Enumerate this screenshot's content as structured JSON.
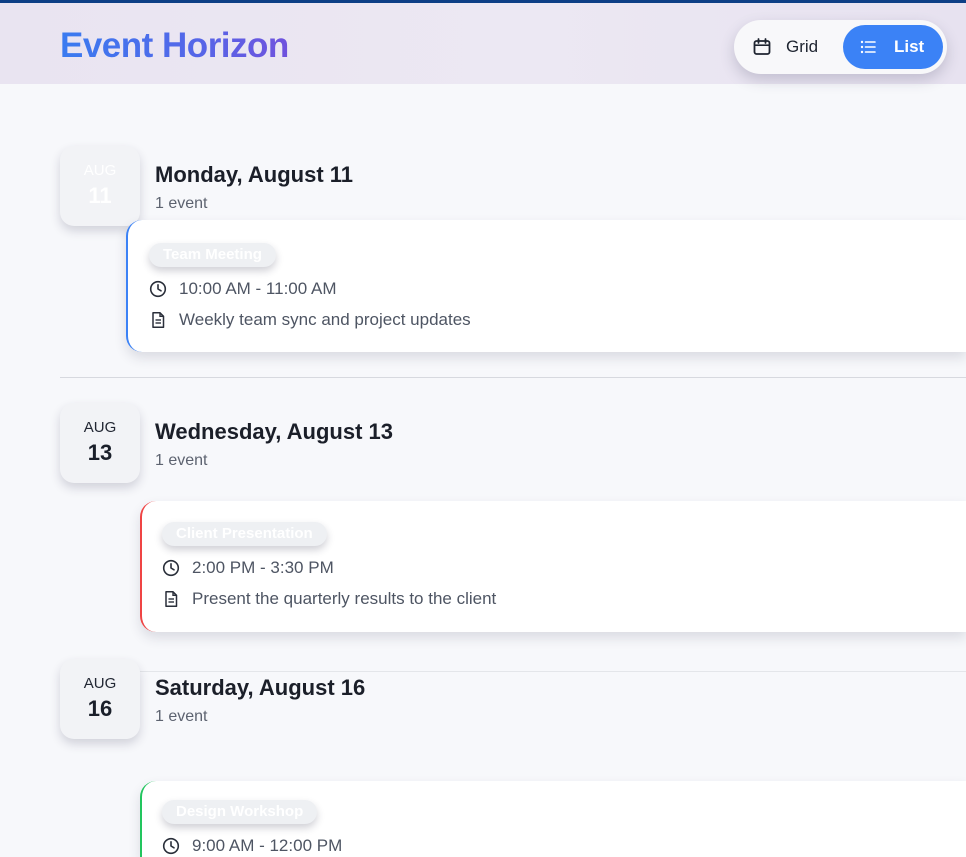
{
  "app": {
    "title": "Event Horizon"
  },
  "view_toggle": {
    "grid_label": "Grid",
    "list_label": "List",
    "active": "List",
    "grid_icon": "calendar-icon",
    "list_icon": "list-icon"
  },
  "days": [
    {
      "month": "AUG",
      "day": "11",
      "title": "Monday, August 11",
      "count": "1 event",
      "events": [
        {
          "name": "Team Meeting",
          "time": "10:00 AM - 11:00 AM",
          "description": "Weekly team sync and project updates",
          "accent_color": "#3b82f6"
        }
      ]
    },
    {
      "month": "AUG",
      "day": "13",
      "title": "Wednesday, August 13",
      "count": "1 event",
      "events": [
        {
          "name": "Client Presentation",
          "time": "2:00 PM - 3:30 PM",
          "description": "Present the quarterly results to the client",
          "accent_color": "#ef4444"
        }
      ]
    },
    {
      "month": "AUG",
      "day": "16",
      "title": "Saturday, August 16",
      "count": "1 event",
      "events": [
        {
          "name": "Design Workshop",
          "time": "9:00 AM - 12:00 PM",
          "accent_color": "#22c55e"
        }
      ]
    }
  ],
  "colors": {
    "brand_gradient_start": "#3a7bf0",
    "brand_gradient_end": "#6f52dd",
    "active_toggle": "#3b82f6",
    "header_band": "#0d3f86"
  }
}
